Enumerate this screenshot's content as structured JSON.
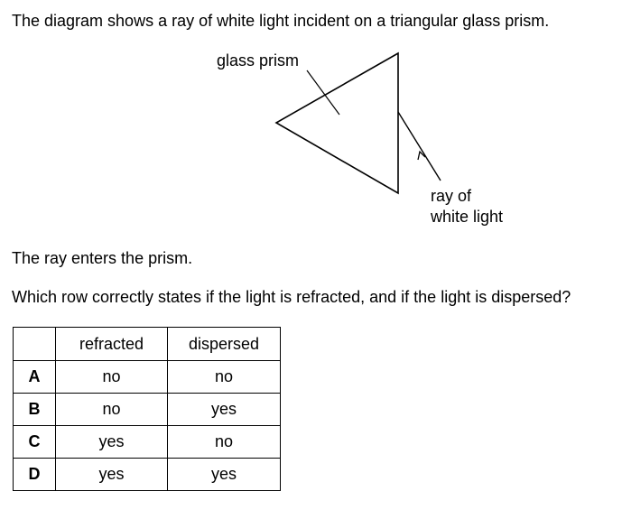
{
  "question": {
    "intro": "The diagram shows a ray of white light incident on a triangular glass prism.",
    "statement": "The ray enters the prism.",
    "prompt": "Which row correctly states if the light is refracted, and if the light is dispersed?"
  },
  "diagram": {
    "prism_label": "glass prism",
    "ray_label_line1": "ray of",
    "ray_label_line2": "white light"
  },
  "table": {
    "headers": [
      "",
      "refracted",
      "dispersed"
    ],
    "rows": [
      {
        "letter": "A",
        "refracted": "no",
        "dispersed": "no"
      },
      {
        "letter": "B",
        "refracted": "no",
        "dispersed": "yes"
      },
      {
        "letter": "C",
        "refracted": "yes",
        "dispersed": "no"
      },
      {
        "letter": "D",
        "refracted": "yes",
        "dispersed": "yes"
      }
    ]
  }
}
